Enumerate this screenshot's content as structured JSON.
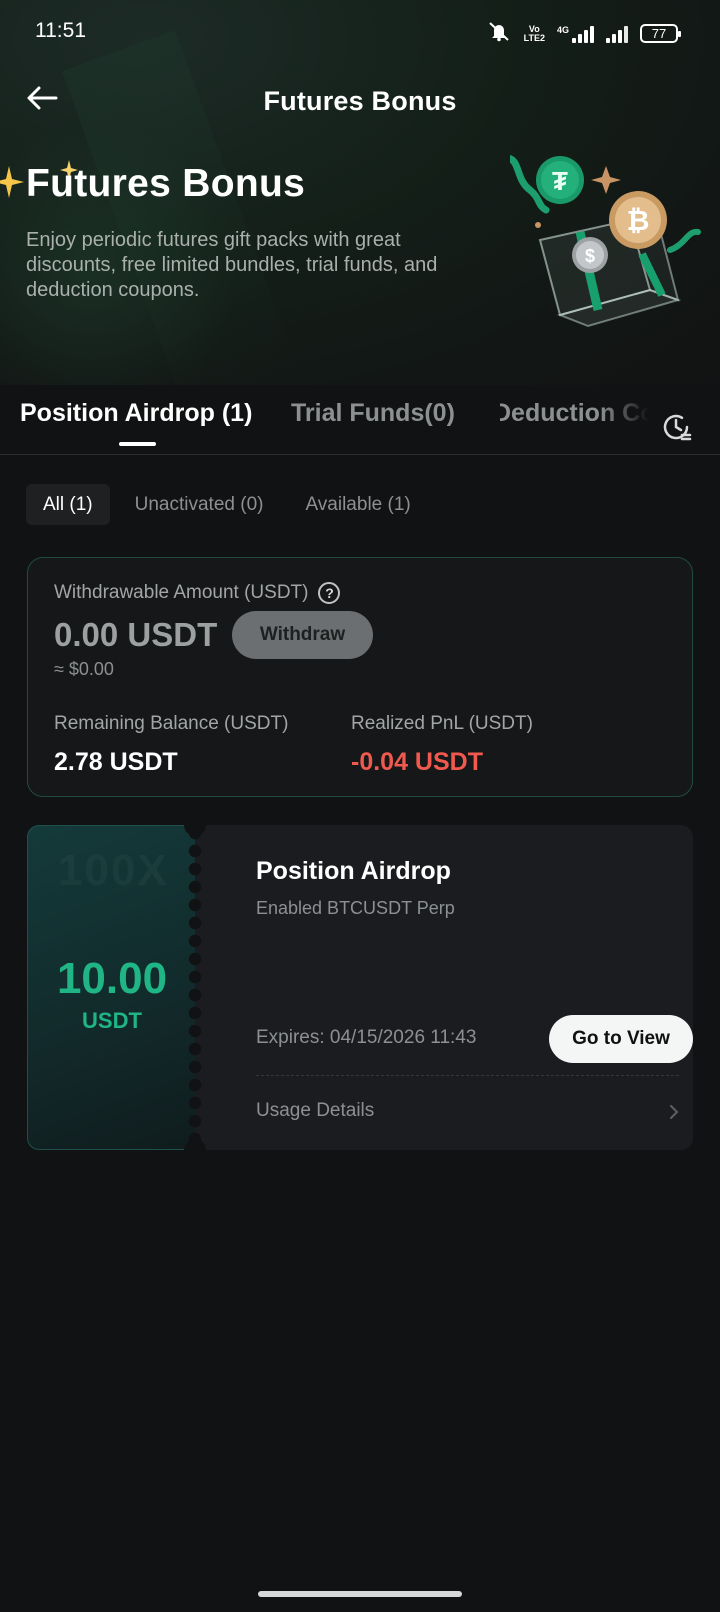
{
  "status_bar": {
    "time": "11:51",
    "network": "4G",
    "battery": "77"
  },
  "header": {
    "title": "Futures Bonus"
  },
  "hero": {
    "title": "Futures Bonus",
    "description": "Enjoy periodic futures gift packs with great discounts, free limited bundles, trial funds, and deduction coupons."
  },
  "tabs": [
    {
      "label": "Position Airdrop (1)",
      "active": true
    },
    {
      "label": "Trial Funds(0)",
      "active": false
    },
    {
      "label": "Deduction Coupons",
      "active": false
    }
  ],
  "filters": [
    {
      "label": "All (1)",
      "active": true
    },
    {
      "label": "Unactivated (0)",
      "active": false
    },
    {
      "label": "Available (1)",
      "active": false
    }
  ],
  "summary": {
    "withdrawable_label": "Withdrawable Amount (USDT)",
    "withdrawable_value": "0.00 USDT",
    "approx_value": "≈ $0.00",
    "withdraw_label": "Withdraw",
    "remaining_label": "Remaining Balance (USDT)",
    "remaining_value": "2.78 USDT",
    "pnl_label": "Realized PnL (USDT)",
    "pnl_value": "-0.04 USDT"
  },
  "voucher": {
    "amount": "10.00",
    "unit": "USDT",
    "title": "Position Airdrop",
    "subtitle": "Enabled BTCUSDT Perp",
    "expiry": "Expires: 04/15/2026 11:43",
    "button_label": "Go to View",
    "usage_label": "Usage Details"
  },
  "colors": {
    "accent_green": "#1fb585",
    "negative_red": "#f0594e",
    "background": "#111213"
  }
}
